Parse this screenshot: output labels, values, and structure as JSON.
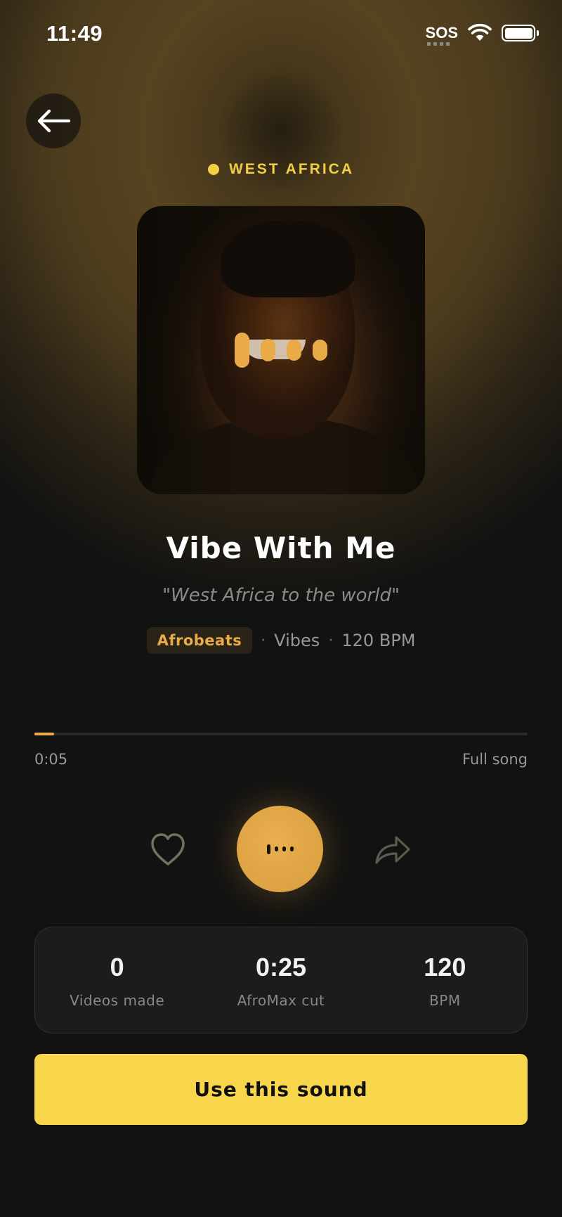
{
  "status_bar": {
    "time": "11:49",
    "sos": "SOS"
  },
  "back_button": {
    "icon": "arrow-left-icon"
  },
  "region": {
    "label": "WEST AFRICA"
  },
  "track": {
    "title": "Vibe With Me",
    "tagline": "\"West Africa to the world\"",
    "genre": "Afrobeats",
    "mood": "Vibes",
    "bpm_label": "120 BPM"
  },
  "progress": {
    "current": "0:05",
    "total_label": "Full song",
    "fraction": 0.04
  },
  "controls": {
    "like_icon": "heart-icon",
    "play_icon": "equalizer-icon",
    "share_icon": "share-arrow-icon"
  },
  "stats": [
    {
      "value": "0",
      "label": "Videos made"
    },
    {
      "value": "0:25",
      "label": "AfroMax cut"
    },
    {
      "value": "120",
      "label": "BPM"
    }
  ],
  "cta": {
    "label": "Use this sound"
  },
  "colors": {
    "accent": "#e9aa47",
    "region": "#f2cf43",
    "cta": "#f8d64c",
    "background": "#121212"
  }
}
